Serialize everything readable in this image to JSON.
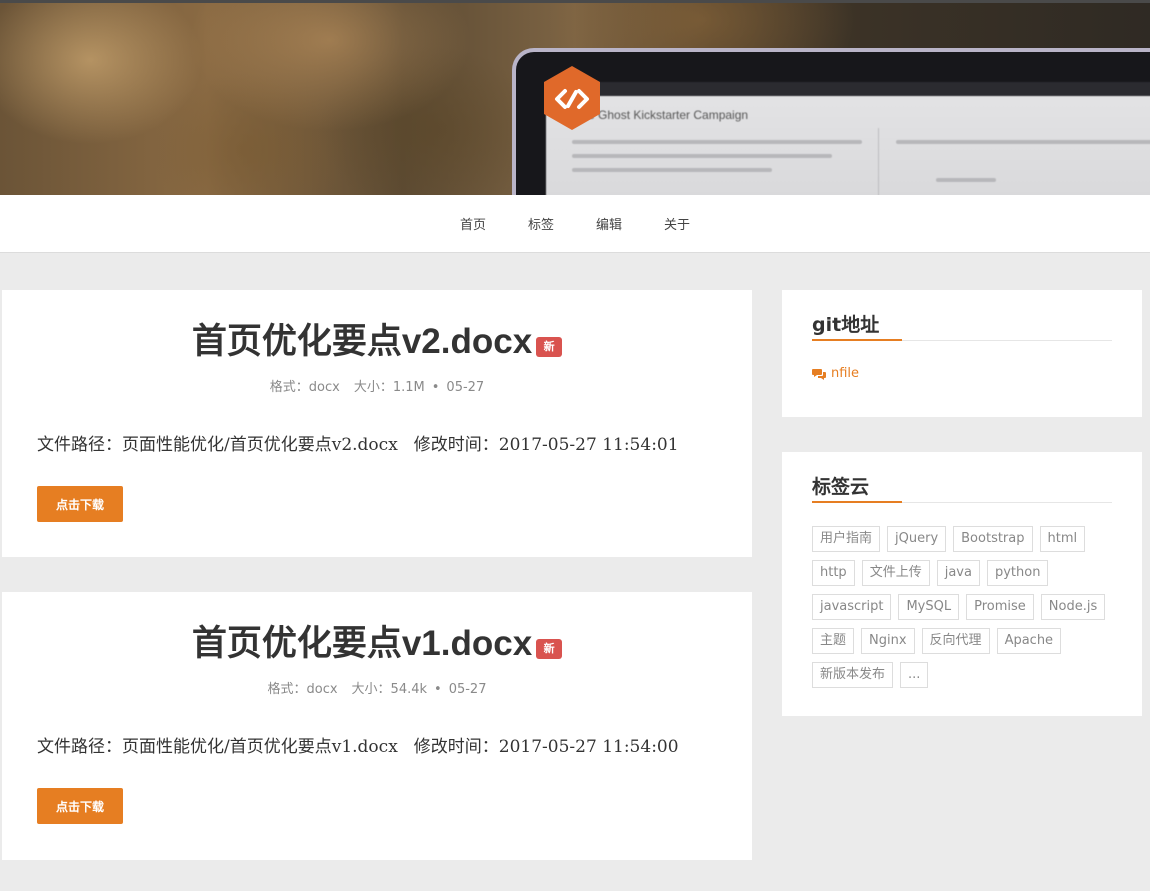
{
  "nav": {
    "items": [
      {
        "label": "首页"
      },
      {
        "label": "标签"
      },
      {
        "label": "编辑"
      },
      {
        "label": "关于"
      }
    ]
  },
  "banner": {
    "screen_title": "The Ghost Kickstarter Campaign"
  },
  "posts": [
    {
      "title": "首页优化要点v2.docx",
      "badge": "新",
      "format": "格式：docx",
      "size": "大小：1.1M",
      "dot": "•",
      "date": "05-27",
      "path": "文件路径：页面性能优化/首页优化要点v2.docx",
      "modified": "修改时间：2017-05-27 11:54:01",
      "button": "点击下载"
    },
    {
      "title": "首页优化要点v1.docx",
      "badge": "新",
      "format": "格式：docx",
      "size": "大小：54.4k",
      "dot": "•",
      "date": "05-27",
      "path": "文件路径：页面性能优化/首页优化要点v1.docx",
      "modified": "修改时间：2017-05-27 11:54:00",
      "button": "点击下载"
    }
  ],
  "sidebar": {
    "git": {
      "title": "git地址",
      "link_icon": "comments-icon",
      "link_label": "nfile"
    },
    "tags": {
      "title": "标签云",
      "rows": [
        [
          "用户指南",
          "jQuery",
          "Bootstrap",
          "html"
        ],
        [
          "http",
          "文件上传",
          "java",
          "python"
        ],
        [
          "javascript",
          "MySQL",
          "Promise",
          "Node.js"
        ],
        [
          "主题",
          "Nginx",
          "反向代理",
          "Apache"
        ],
        [
          "新版本发布",
          "..."
        ]
      ]
    }
  },
  "colors": {
    "accent": "#e67e22",
    "badge": "#d9534f",
    "page_bg": "#ebebeb"
  }
}
